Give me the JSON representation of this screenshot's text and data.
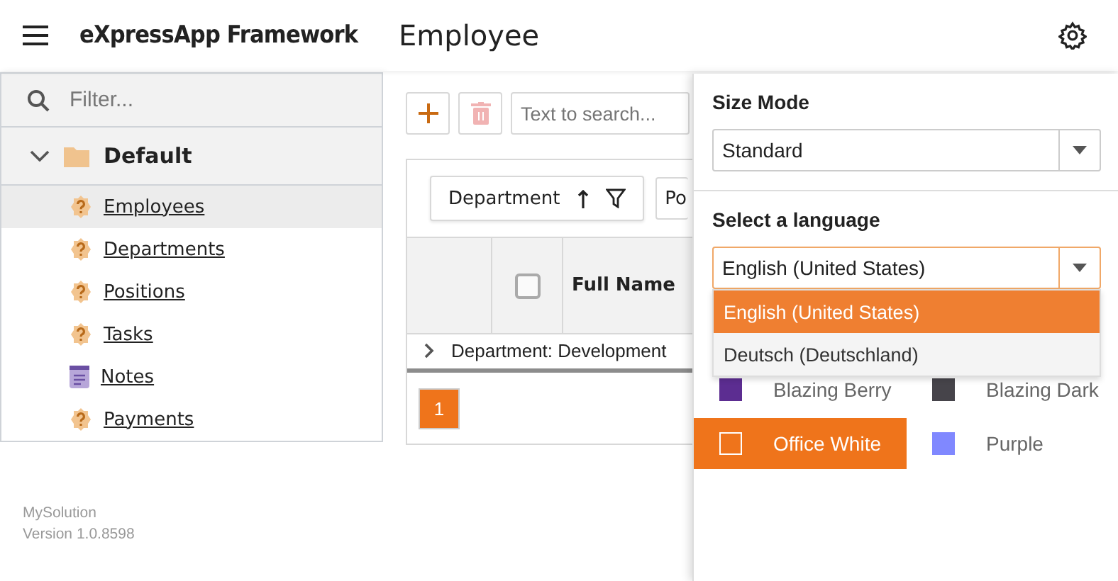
{
  "header": {
    "app_title": "eXpressApp Framework",
    "view_title": "Employee"
  },
  "sidebar": {
    "filter_placeholder": "Filter...",
    "group": {
      "label": "Default",
      "expanded": true,
      "items": [
        {
          "label": "Employees",
          "kind": "question",
          "selected": true
        },
        {
          "label": "Departments",
          "kind": "question",
          "selected": false
        },
        {
          "label": "Positions",
          "kind": "question",
          "selected": false
        },
        {
          "label": "Tasks",
          "kind": "question",
          "selected": false
        },
        {
          "label": "Notes",
          "kind": "note",
          "selected": false
        },
        {
          "label": "Payments",
          "kind": "question",
          "selected": false
        }
      ]
    },
    "footer": [
      "MySolution",
      "Version 1.0.8598"
    ]
  },
  "toolbar": {
    "search_placeholder": "Text to search..."
  },
  "grid": {
    "group_panel": [
      {
        "label": "Department"
      },
      {
        "label": "Po"
      }
    ],
    "select_all": {
      "checked": false
    },
    "columns": [
      "Full Name"
    ],
    "group_row": "Department: Development",
    "pager": [
      {
        "label": "1",
        "selected": true
      }
    ]
  },
  "settings": {
    "size_mode": {
      "label": "Size Mode",
      "value": "Standard"
    },
    "language": {
      "label": "Select a language",
      "value": "English (United States)",
      "options": [
        {
          "label": "English (United States)",
          "selected": true
        },
        {
          "label": "Deutsch (Deutschland)",
          "selected": false
        }
      ]
    },
    "themes": [
      {
        "label": "Blazing Berry",
        "color": "#5c2d91",
        "selected": false
      },
      {
        "label": "Blazing Dark",
        "color": "#46444a",
        "selected": false
      },
      {
        "label": "Office White",
        "color": "#ffffff",
        "selected": true
      },
      {
        "label": "Purple",
        "color": "#8088ff",
        "selected": false
      }
    ]
  }
}
